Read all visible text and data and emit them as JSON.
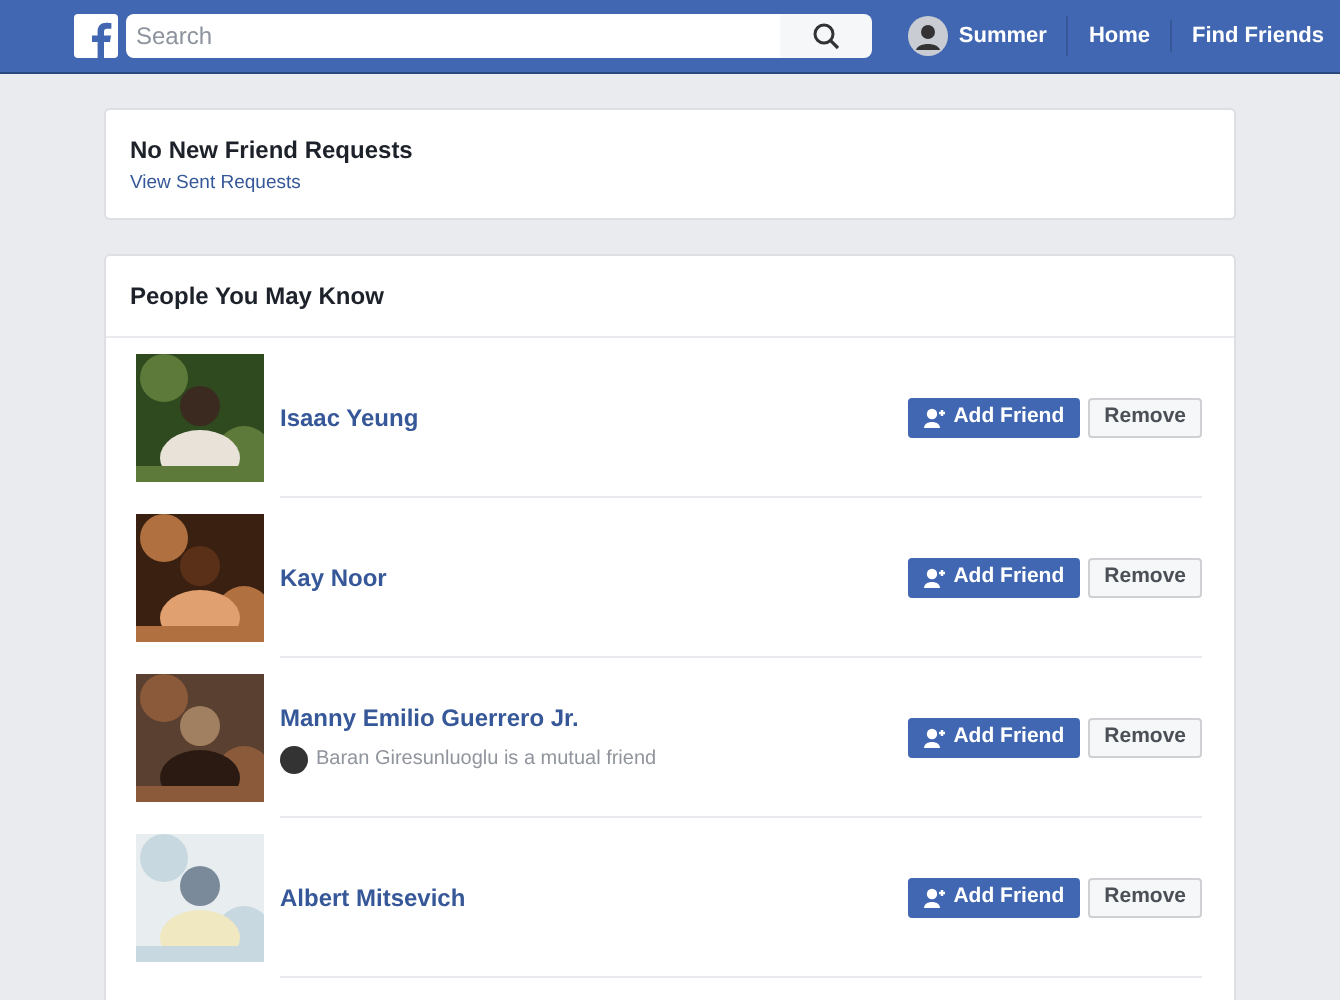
{
  "header": {
    "search": {
      "placeholder": "Search"
    },
    "nav": [
      {
        "label": "Summer",
        "kind": "profile"
      },
      {
        "label": "Home",
        "kind": "link"
      },
      {
        "label": "Find Friends",
        "kind": "link"
      }
    ]
  },
  "requests": {
    "title": "No New Friend Requests",
    "link": "View Sent Requests"
  },
  "suggestions": {
    "title": "People You May Know",
    "people": [
      {
        "name": "Isaac Yeung",
        "add": "Add Friend",
        "remove": "Remove"
      },
      {
        "name": "Kay Noor",
        "add": "Add Friend",
        "remove": "Remove"
      },
      {
        "name": "Manny Emilio Guerrero Jr.",
        "mutual": "Baran Giresunluoglu is a mutual friend",
        "add": "Add Friend",
        "remove": "Remove"
      },
      {
        "name": "Albert Mitsevich",
        "add": "Add Friend",
        "remove": "Remove"
      }
    ]
  }
}
